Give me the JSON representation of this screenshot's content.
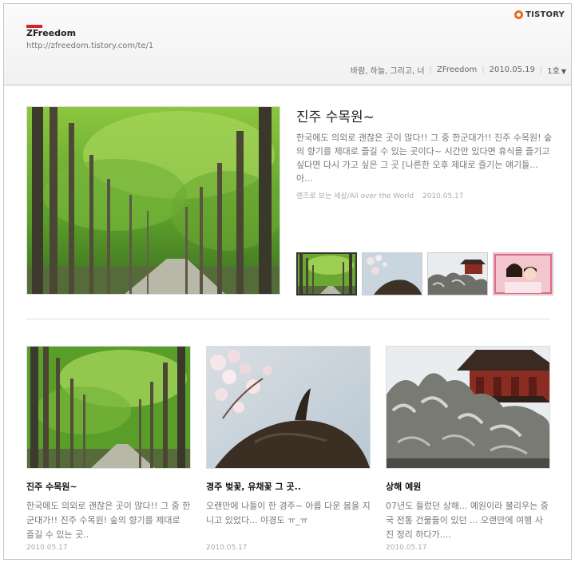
{
  "header": {
    "blog_name": "ZFreedom",
    "blog_url": "http://zfreedom.tistory.com/te/1",
    "brand": "TISTORY",
    "meta": {
      "category": "바람, 하늘, 그리고, 너",
      "author": "ZFreedom",
      "date": "2010.05.19",
      "issue": "1호"
    }
  },
  "featured": {
    "title": "진주 수목원~",
    "excerpt": "한국에도 의외로 괜찮은 곳이 많다!! 그 중 한군대가!! 진주 수목원! 숲의 향기를 제대로 즐길 수 있는 곳이다~ 시간만 있다면 휴식을 즐기고 싶다면 다시 가고 싶은 그 곳 [나른한 오후 제대로 즐기는 얘기들...아...",
    "category": "렌즈로 보는 세상/All over the World",
    "date": "2010.05.17"
  },
  "thumbnails": [
    "forest-path",
    "cherry-blossom",
    "pagoda-rocks",
    "couple-photo"
  ],
  "cards": [
    {
      "title": "진주 수목원~",
      "excerpt": "한국에도 의외로 괜찮은 곳이 많다!! 그 중 한군대가!! 진주 수목원! 숲의 향기를 제대로 즐길 수 있는 곳..",
      "date": "2010.05.17"
    },
    {
      "title": "경주 벚꽃, 유채꽃 그 곳..",
      "excerpt": "오랜만에 나들이 한 경주~ 아름 다운 봄을 지니고 있었다... 야경도 ㅠ_ㅠ",
      "date": "2010.05.17"
    },
    {
      "title": "상해 예원",
      "excerpt": "07년도 들렀던 상해... 예원이라 불리우는 중국 전통 건물들이 있던 ... 오랜만에 여행 사진 정리 하다가....",
      "date": "2010.05.17"
    }
  ],
  "colors": {
    "brand_red": "#e02020",
    "tistory_orange": "#e86a1e",
    "forest_green": "#4f9a2a"
  }
}
